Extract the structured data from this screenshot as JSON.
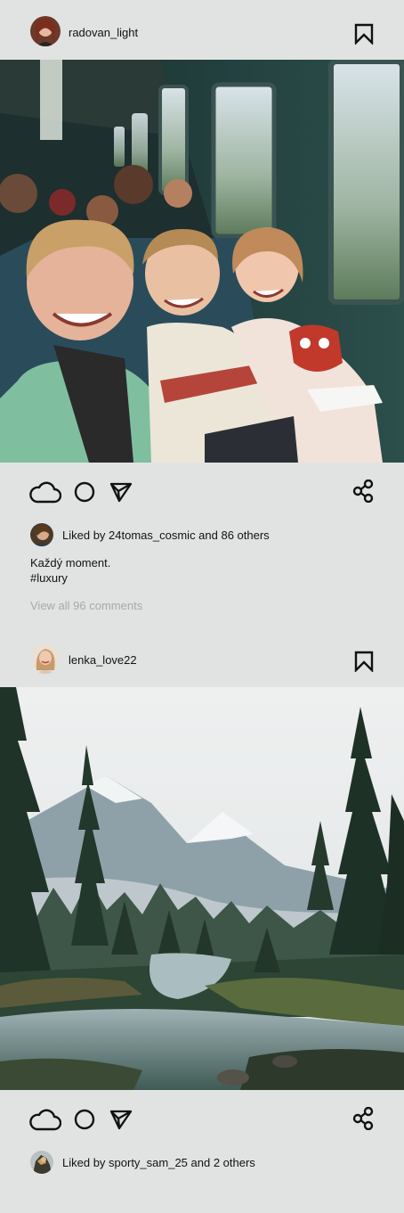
{
  "posts": [
    {
      "username": "radovan_light",
      "avatar_icon": "user-avatar",
      "likes_text": "Liked by 24tomas_cosmic and 86 others",
      "caption_line1": "Každý moment.",
      "caption_line2": "#luxury",
      "view_comments": "View all 96 comments",
      "image_description": "children-on-train-photo"
    },
    {
      "username": "lenka_love22",
      "avatar_icon": "user-avatar",
      "likes_text": "Liked by sporty_sam_25 and 2 others",
      "image_description": "mountain-lake-forest-photo"
    }
  ],
  "icons": {
    "like": "cloud-icon",
    "comment": "circle-icon",
    "send": "send-icon",
    "share": "share-icon",
    "save": "bookmark-icon"
  },
  "colors": {
    "background": "#e1e3e2",
    "text": "#111111",
    "muted": "#a7a9a8"
  }
}
